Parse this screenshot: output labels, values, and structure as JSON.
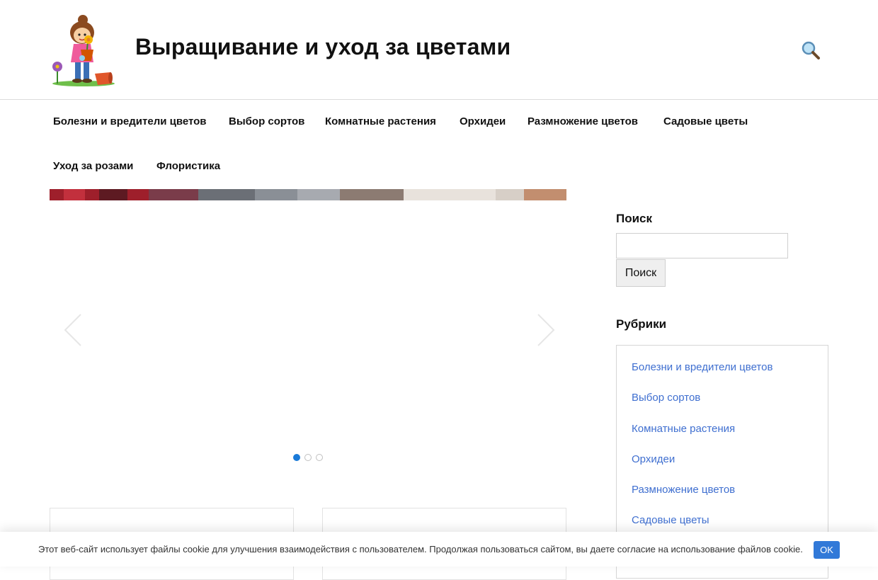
{
  "site": {
    "title": "Выращивание и уход за цветами"
  },
  "header": {
    "logo_icon": "girl-with-flower-pot-logo",
    "search_icon": "search-icon"
  },
  "nav": {
    "items": [
      {
        "label": "Болезни и вредители цветов"
      },
      {
        "label": "Выбор сортов"
      },
      {
        "label": "Комнатные растения"
      },
      {
        "label": "Орхидеи"
      },
      {
        "label": "Размножение цветов"
      },
      {
        "label": "Садовые цветы"
      },
      {
        "label": "Уход за розами"
      },
      {
        "label": "Флористика"
      }
    ]
  },
  "slider": {
    "slide_count": 3,
    "active_slide": 1,
    "prev_icon": "chevron-left-icon",
    "next_icon": "chevron-right-icon"
  },
  "sidebar": {
    "search": {
      "title": "Поиск",
      "input_value": "",
      "button_label": "Поиск"
    },
    "categories": {
      "title": "Рубрики",
      "items": [
        {
          "label": "Болезни и вредители цветов"
        },
        {
          "label": "Выбор сортов"
        },
        {
          "label": "Комнатные растения"
        },
        {
          "label": "Орхидеи"
        },
        {
          "label": "Размножение цветов"
        },
        {
          "label": "Садовые цветы"
        }
      ]
    }
  },
  "cookie": {
    "text": "Этот веб-сайт использует файлы cookie для улучшения взаимодействия с пользователем. Продолжая пользоваться сайтом, вы даете согласие на использование файлов cookie.",
    "ok_label": "OK"
  },
  "colors": {
    "link": "#3f6fd0",
    "accent": "#1a7ad8",
    "cookie_button": "#3179d8"
  }
}
